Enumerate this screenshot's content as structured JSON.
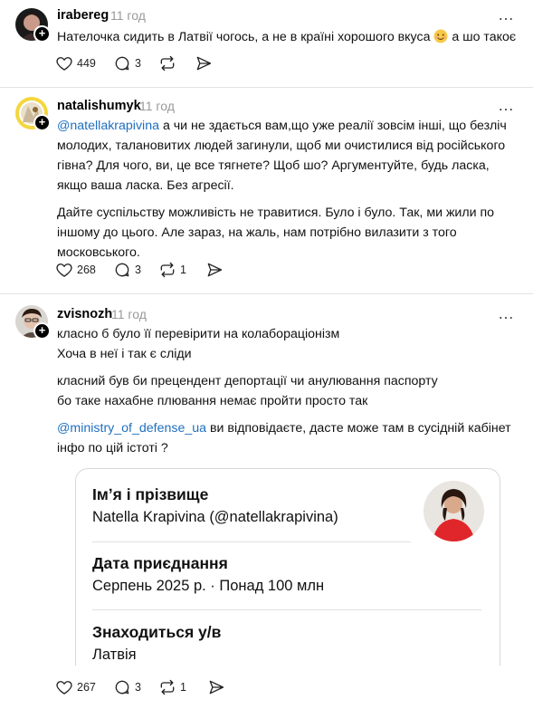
{
  "posts": [
    {
      "username": "irabereg",
      "time": "11 год",
      "text": "Нателочка сидить в Латвії чогось, а не в країні хорошого вкуса",
      "text_after_emoji": "а шо такоє",
      "likes": "449",
      "replies": "3",
      "reposts": "",
      "icons": [
        "heart-icon",
        "comment-icon",
        "repost-icon",
        "share-icon"
      ]
    },
    {
      "username": "natalishumyk",
      "time": "11 год",
      "mention": "@natellakrapivina",
      "paragraph1": "а чи не здається вам,що уже реалії зовсім інші, що безліч молодих, талановитих людей загинули, щоб ми очистилися від російського гівна? Для чого, ви, це все тягнете? Щоб шо? Аргументуйте, будь ласка, якщо ваша ласка. Без агресії.",
      "paragraph2": "Дайте суспільству можливість не травитися. Було і було. Так, ми жили по іншому до цього. Але зараз, на жаль, нам потрібно вилазити з того московського.",
      "likes": "268",
      "replies": "3",
      "reposts": "1"
    },
    {
      "username": "zvisnozh",
      "time": "11 год",
      "line1": "класно б було її перевірити на колабораціонізм",
      "line2": "Хоча в неї і так є сліди",
      "line3": "класний був би прецендент депортації чи анулювання паспорту",
      "line4": "бо таке нахабне плювання немає пройти просто так",
      "mention": "@ministry_of_defense_ua",
      "line5": "ви відповідаєте, дасте може там в сусідній кабінет інфо по цій істоті ?",
      "likes": "267",
      "replies": "3",
      "reposts": "1"
    }
  ],
  "profile_card": {
    "name_label": "Імʼя і прізвище",
    "name_value": "Natella Krapivina (@natellakrapivina)",
    "joined_label": "Дата приєднання",
    "joined_value": "Серпень 2025 р. · Понад 100 млн",
    "location_label": "Знаходиться у/в",
    "location_value": "Латвія"
  },
  "more_icon": "…",
  "colors": {
    "mention": "#1f6fbf",
    "time": "#999999",
    "divider": "#e3e3e3"
  }
}
